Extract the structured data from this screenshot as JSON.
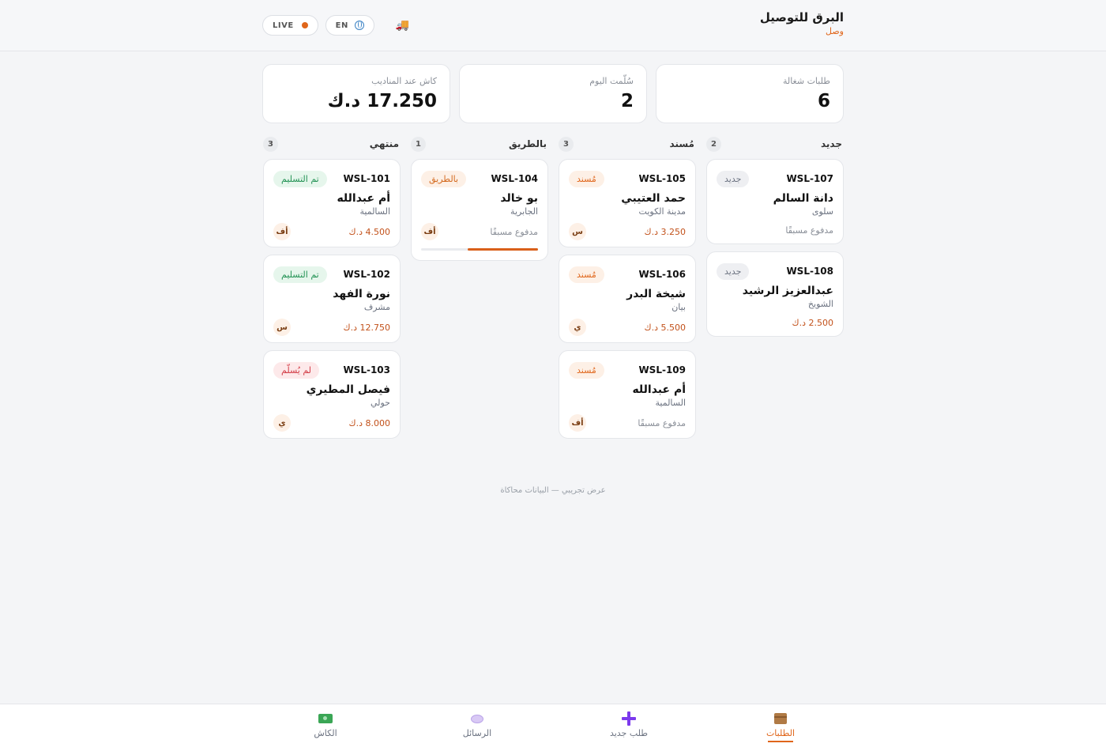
{
  "header": {
    "brand_title": "البرق للتوصيل",
    "brand_sub": "وصل",
    "live_label": "LIVE",
    "lang_label": "EN"
  },
  "stats": [
    {
      "label": "طلبات شغالة",
      "value": "6"
    },
    {
      "label": "سُلّمت اليوم",
      "value": "2"
    },
    {
      "label": "كاش عند المناديب",
      "value": "17.250 د.ك"
    }
  ],
  "columns": {
    "new": {
      "title": "جديد",
      "count": "2",
      "cards": [
        {
          "id": "WSL-107",
          "status": "جديد",
          "customer": "دانة السالم",
          "area": "سلوى",
          "payment": "مدفوع مسبقًا"
        },
        {
          "id": "WSL-108",
          "status": "جديد",
          "customer": "عبدالعزيز الرشيد",
          "area": "الشويخ",
          "amount": "2.500 د.ك"
        }
      ]
    },
    "assigned": {
      "title": "مُسند",
      "count": "3",
      "cards": [
        {
          "id": "WSL-105",
          "status": "مُسند",
          "customer": "حمد العتيبي",
          "area": "مدينة الكويت",
          "amount": "3.250 د.ك",
          "driver": "س"
        },
        {
          "id": "WSL-106",
          "status": "مُسند",
          "customer": "شيخة البدر",
          "area": "بيان",
          "amount": "5.500 د.ك",
          "driver": "ي"
        },
        {
          "id": "WSL-109",
          "status": "مُسند",
          "customer": "أم عبدالله",
          "area": "السالمية",
          "payment": "مدفوع مسبقًا",
          "driver": "أف"
        }
      ]
    },
    "on_the_way": {
      "title": "بالطريق",
      "count": "1",
      "cards": [
        {
          "id": "WSL-104",
          "status": "بالطريق",
          "customer": "بو خالد",
          "area": "الجابرية",
          "payment": "مدفوع مسبقًا",
          "driver": "أف",
          "progress": 0.6
        }
      ]
    },
    "done": {
      "title": "منتهي",
      "count": "3",
      "cards": [
        {
          "id": "WSL-101",
          "status": "تم التسليم",
          "customer": "أم عبدالله",
          "area": "السالمية",
          "amount": "4.500 د.ك",
          "driver": "أف"
        },
        {
          "id": "WSL-102",
          "status": "تم التسليم",
          "customer": "نورة الفهد",
          "area": "مشرف",
          "amount": "12.750 د.ك",
          "driver": "س"
        },
        {
          "id": "WSL-103",
          "status": "لم يُسلّم",
          "customer": "فيصل المطيري",
          "area": "حولي",
          "amount": "8.000 د.ك",
          "driver": "ي"
        }
      ]
    }
  },
  "footnote": "عرض تجريبي — البيانات محاكاة",
  "nav": {
    "orders": {
      "label": "الطلبات",
      "icon": "package-icon"
    },
    "new_order": {
      "label": "طلب جديد",
      "icon": "plus-icon"
    },
    "messages": {
      "label": "الرسائل",
      "icon": "chat-icon"
    },
    "cash": {
      "label": "الكاش",
      "icon": "cash-icon"
    }
  },
  "colors": {
    "accent": "#e0661b",
    "delivered": "#229254",
    "failed": "#d23a44"
  }
}
